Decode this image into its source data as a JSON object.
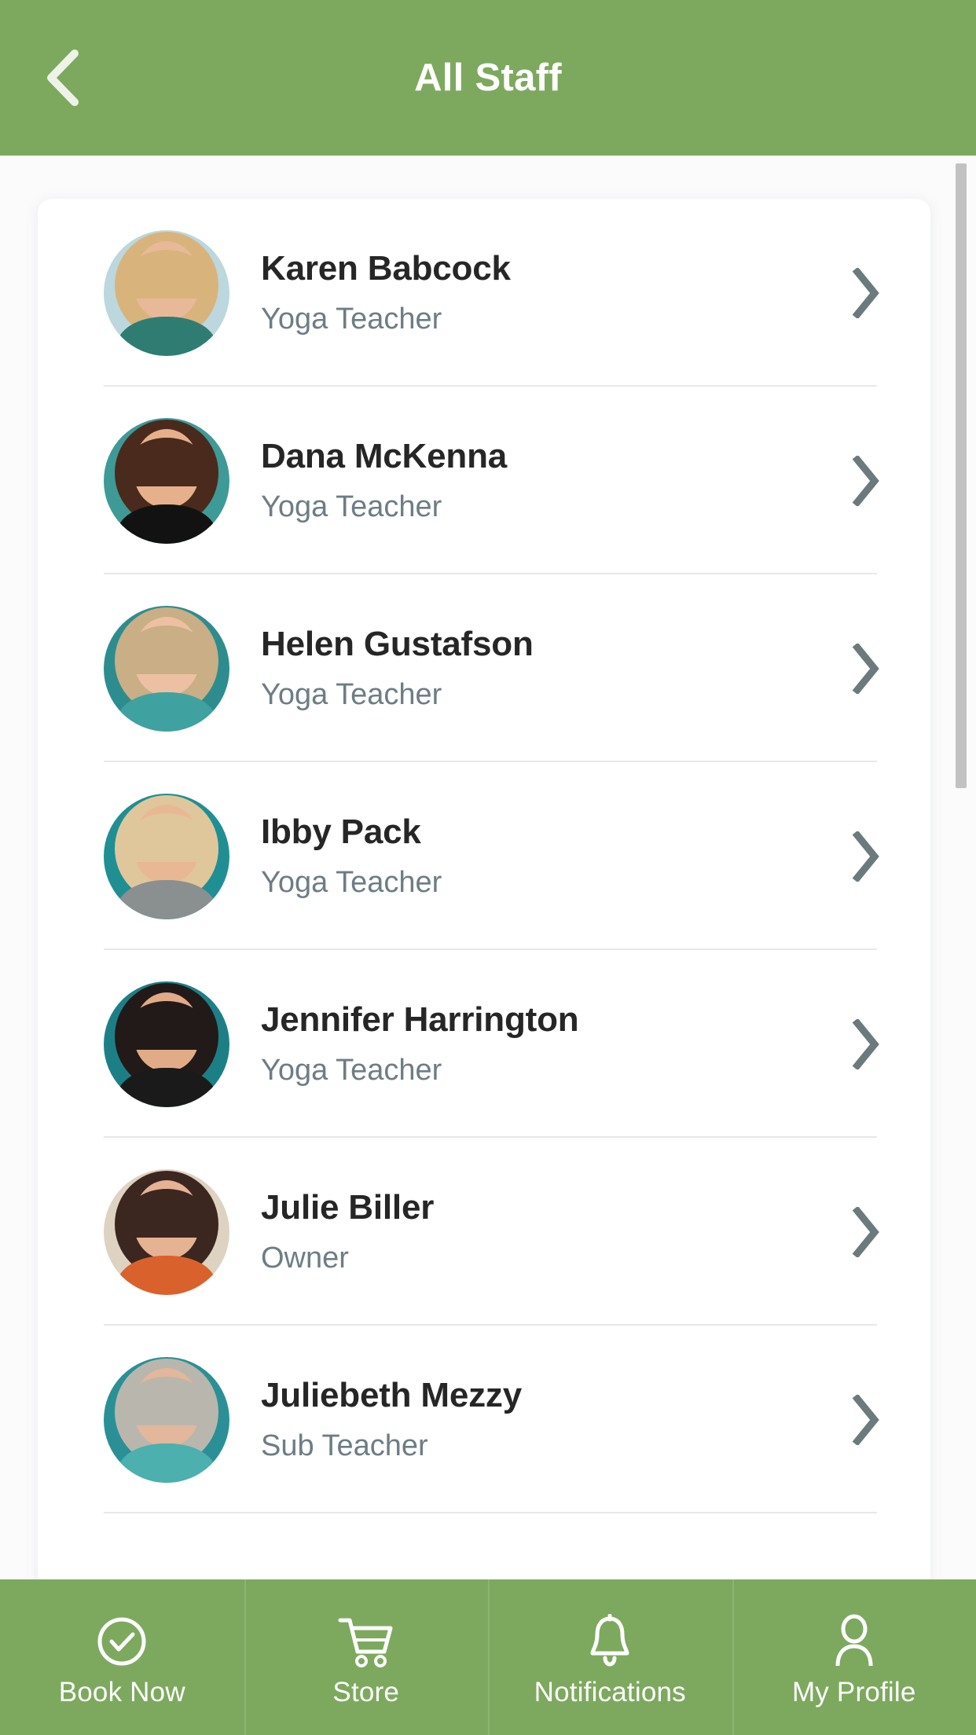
{
  "header": {
    "title": "All Staff",
    "back_icon": "chevron-left-icon",
    "background_color": "#7da95e",
    "title_color": "#ffffff"
  },
  "staff_list": {
    "row_chevron_icon": "chevron-right-icon",
    "items": [
      {
        "name": "Karen Babcock",
        "role": "Yoga Teacher",
        "avatar": {
          "name": "avatar-karen-babcock",
          "bg": "#bcd7dd",
          "hair": "#d8b47c",
          "skin": "#e8b999",
          "torso": "#2f7d72"
        }
      },
      {
        "name": "Dana McKenna",
        "role": "Yoga Teacher",
        "avatar": {
          "name": "avatar-dana-mckenna",
          "bg": "#3e9a96",
          "hair": "#4a2a1d",
          "skin": "#e6b08c",
          "torso": "#121212"
        }
      },
      {
        "name": "Helen Gustafson",
        "role": "Yoga Teacher",
        "avatar": {
          "name": "avatar-helen-gustafson",
          "bg": "#2d8d8e",
          "hair": "#c9ae86",
          "skin": "#edc0a3",
          "torso": "#3fa2a0"
        }
      },
      {
        "name": "Ibby Pack",
        "role": "Yoga Teacher",
        "avatar": {
          "name": "avatar-ibby-pack",
          "bg": "#1f8f94",
          "hair": "#e0c79b",
          "skin": "#e8b894",
          "torso": "#8a8f90"
        }
      },
      {
        "name": "Jennifer Harrington",
        "role": "Yoga Teacher",
        "avatar": {
          "name": "avatar-jennifer-harrington",
          "bg": "#1d7f86",
          "hair": "#221a18",
          "skin": "#e2ab88",
          "torso": "#1a1a1a"
        }
      },
      {
        "name": "Julie Biller",
        "role": "Owner",
        "avatar": {
          "name": "avatar-julie-biller",
          "bg": "#ded3c2",
          "hair": "#3b2720",
          "skin": "#e5b293",
          "torso": "#d9622c"
        }
      },
      {
        "name": "Juliebeth Mezzy",
        "role": "Sub Teacher",
        "avatar": {
          "name": "avatar-juliebeth-mezzy",
          "bg": "#2a9096",
          "hair": "#b9b6ae",
          "skin": "#e2b79b",
          "torso": "#4bb0ae"
        }
      }
    ]
  },
  "scrollbar": {
    "name": "vertical-scrollbar",
    "color": "#c2c2c2"
  },
  "bottom_nav": {
    "background_color": "#7da95e",
    "items": [
      {
        "label": "Book Now",
        "icon": "check-circle-icon"
      },
      {
        "label": "Store",
        "icon": "shopping-cart-icon"
      },
      {
        "label": "Notifications",
        "icon": "bell-icon"
      },
      {
        "label": "My Profile",
        "icon": "person-icon"
      }
    ]
  }
}
